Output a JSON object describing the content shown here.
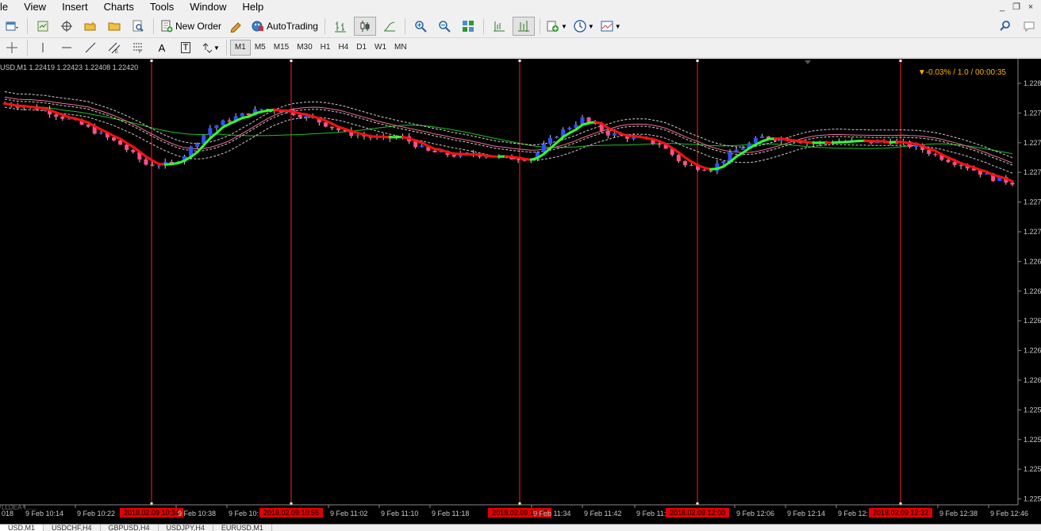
{
  "menu": [
    "le",
    "View",
    "Insert",
    "Charts",
    "Tools",
    "Window",
    "Help"
  ],
  "window_controls": {
    "minimize": "_",
    "restore": "❐",
    "close": "×"
  },
  "toolbar": {
    "new_order": "New Order",
    "auto_trading": "AutoTrading",
    "timeframes": [
      "M1",
      "M5",
      "M15",
      "M30",
      "H1",
      "H4",
      "D1",
      "W1",
      "MN"
    ],
    "active_timeframe": "M1",
    "text_tool": "A",
    "label_tool": "T"
  },
  "chart": {
    "info": "USD,M1  1.22419 1.22423 1.22408 1.22420",
    "status": "▼-0.03% / 1.0 / 00:00:35",
    "overlay_text": "LLDEA T......",
    "colors": {
      "background": "#000000",
      "bull": "#3050ff",
      "bear": "#ff4d8a",
      "ma_down": "#ff1010",
      "ma_up": "#30ff30",
      "band": "#cfcfcf",
      "pink_ma": "#f07090",
      "green_ma": "#20c020",
      "vline": "#ff2020"
    },
    "price_labels": [
      "1.228",
      "1.227",
      "1.227",
      "1.227",
      "1.227",
      "1.227",
      "1.226",
      "1.226",
      "1.226",
      "1.226",
      "1.226",
      "1.225",
      "1.225",
      "1.225",
      "1.225"
    ],
    "time_labels": [
      "018",
      "9 Feb 10:14",
      "9 Feb 10:22",
      "9 Feb 10:38",
      "9 Feb 10:",
      "9 Feb 11:02",
      "9 Feb 11:10",
      "9 Feb 11:18",
      "9 Feb 11:34",
      "9 Feb 11:42",
      "9 Feb 11:",
      "9 Feb 12:06",
      "9 Feb 12:14",
      "9 Feb 12:",
      "9 Feb 12:38",
      "9 Feb 12:46"
    ],
    "highlight_labels": [
      "2018.02.09 10:34",
      "2018.02.09 10:56",
      "2018.02.09 11:32",
      "2018.02.09 12:00",
      "2018.02.09 12:32"
    ]
  },
  "tabs": [
    "USD,M1",
    "USDCHF,H4",
    "GBPUSD,H4",
    "USDJPY,H4",
    "EURUSD,M1"
  ]
}
